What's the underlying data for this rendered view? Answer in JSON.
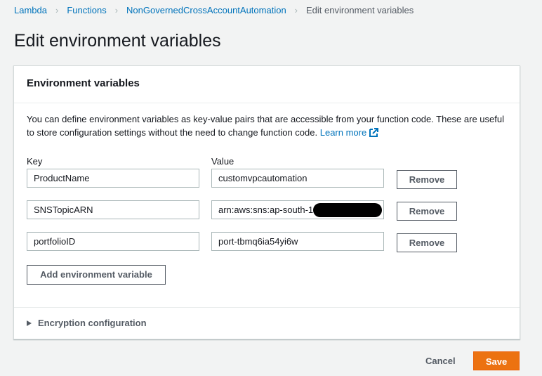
{
  "breadcrumb": [
    "Lambda",
    "Functions",
    "NonGovernedCrossAccountAutomation",
    "Edit environment variables"
  ],
  "page_title": "Edit environment variables",
  "panel": {
    "title": "Environment variables",
    "description": "You can define environment variables as key-value pairs that are accessible from your function code. These are useful to store configuration settings without the need to change function code.",
    "learn_more": "Learn more",
    "key_label": "Key",
    "value_label": "Value",
    "rows": [
      {
        "key": "ProductName",
        "value": "customvpcautomation",
        "remove": "Remove"
      },
      {
        "key": "SNSTopicARN",
        "value": "arn:aws:sns:ap-south-1:",
        "remove": "Remove"
      },
      {
        "key": "portfolioID",
        "value": "port-tbmq6ia54yi6w",
        "remove": "Remove"
      }
    ],
    "add_button": "Add environment variable",
    "encryption": "Encryption configuration"
  },
  "footer": {
    "cancel": "Cancel",
    "save": "Save"
  },
  "colors": {
    "link": "#0073bb",
    "primary": "#ec7211"
  }
}
